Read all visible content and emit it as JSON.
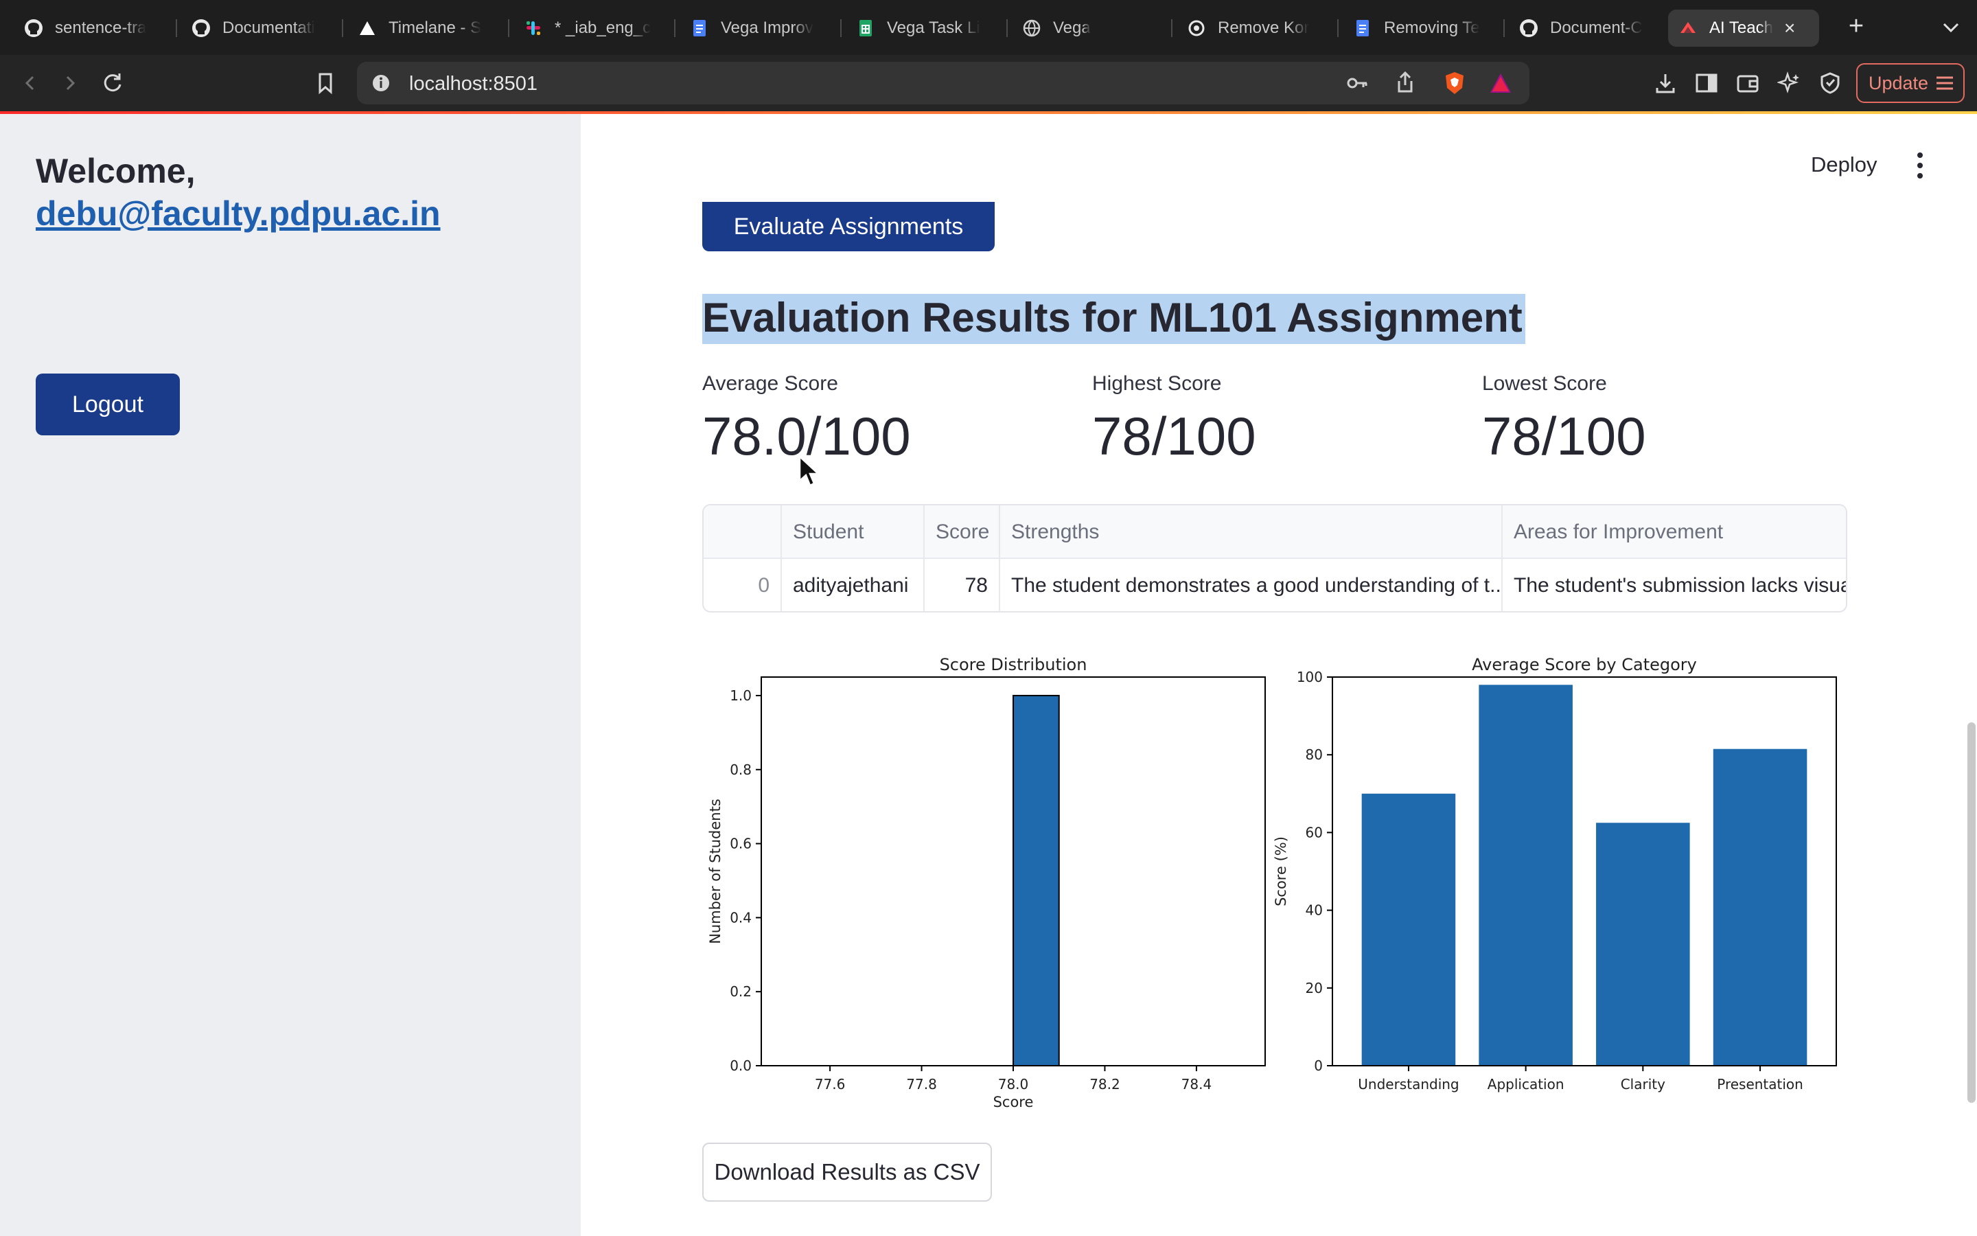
{
  "browser": {
    "tabs": [
      {
        "label": "sentence-tra",
        "icon": "github-icon"
      },
      {
        "label": "Documentati",
        "icon": "github-icon"
      },
      {
        "label": "Timelane - S",
        "icon": "timelane-icon"
      },
      {
        "label": "* _iab_eng_c",
        "icon": "slack-icon"
      },
      {
        "label": "Vega Improv",
        "icon": "google-docs-icon"
      },
      {
        "label": "Vega Task Li",
        "icon": "google-sheets-icon"
      },
      {
        "label": "Vega",
        "icon": "globe-icon"
      },
      {
        "label": "Remove Kor",
        "icon": "openai-icon"
      },
      {
        "label": "Removing Te",
        "icon": "google-docs-icon"
      },
      {
        "label": "Document-C",
        "icon": "github-icon"
      },
      {
        "label": "AI Teach",
        "icon": "streamlit-icon",
        "active": true
      }
    ],
    "url": "localhost:8501",
    "update_label": "Update"
  },
  "sidebar": {
    "welcome": "Welcome,",
    "email": "debu@faculty.pdpu.ac.in",
    "logout_label": "Logout"
  },
  "header": {
    "deploy_label": "Deploy"
  },
  "main": {
    "evaluate_label": "Evaluate Assignments",
    "results_title": "Evaluation Results for ML101 Assignment",
    "metrics": [
      {
        "label": "Average Score",
        "value": "78.0/100"
      },
      {
        "label": "Highest Score",
        "value": "78/100"
      },
      {
        "label": "Lowest Score",
        "value": "78/100"
      }
    ],
    "table": {
      "columns": [
        "",
        "Student",
        "Score",
        "Strengths",
        "Areas for Improvement"
      ],
      "rows": [
        [
          "0",
          "adityajethani",
          "78",
          "The student demonstrates a good understanding of t...",
          "The student's submission lacks visual"
        ]
      ]
    },
    "download_label": "Download Results as CSV"
  },
  "chart_data": [
    {
      "type": "bar",
      "title": "Score Distribution",
      "xlabel": "Score",
      "ylabel": "Number of Students",
      "x_ticks": [
        "77.6",
        "77.8",
        "78.0",
        "78.2",
        "78.4"
      ],
      "y_ticks": [
        "0.0",
        "0.2",
        "0.4",
        "0.6",
        "0.8",
        "1.0"
      ],
      "xlim": [
        77.45,
        78.55
      ],
      "ylim": [
        0,
        1.05
      ],
      "bins": [
        {
          "x0": 78.0,
          "x1": 78.1,
          "value": 1
        }
      ],
      "color": "#1f6aad"
    },
    {
      "type": "bar",
      "title": "Average Score by Category",
      "xlabel": "",
      "ylabel": "Score (%)",
      "categories": [
        "Understanding",
        "Application",
        "Clarity",
        "Presentation"
      ],
      "values": [
        70,
        98,
        62.5,
        81.5
      ],
      "y_ticks": [
        "0",
        "20",
        "40",
        "60",
        "80",
        "100"
      ],
      "ylim": [
        0,
        100
      ],
      "color": "#1f6aad"
    }
  ]
}
